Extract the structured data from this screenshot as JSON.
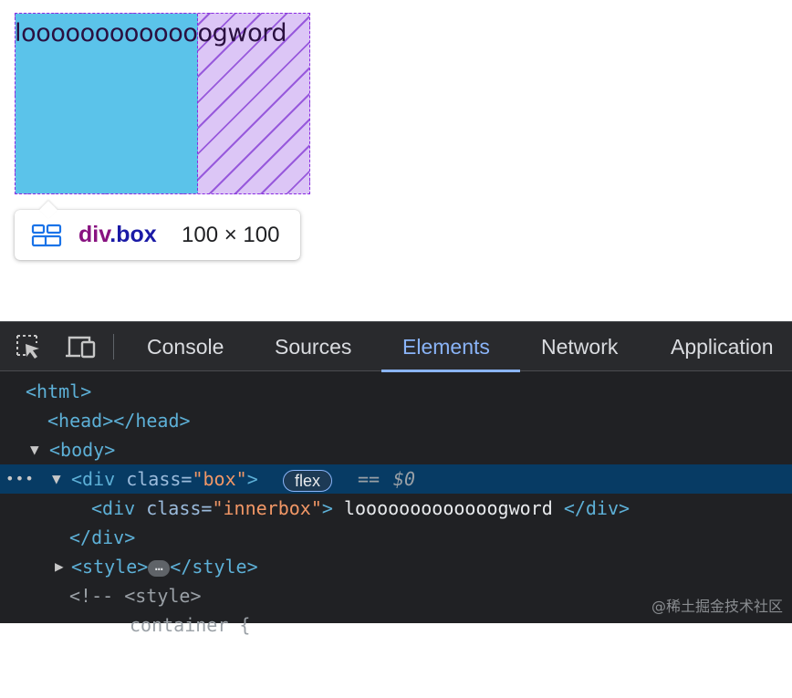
{
  "preview": {
    "box_text": "looooooooooooogword",
    "tooltip": {
      "tag": "div",
      "class": ".box",
      "size": "100 × 100"
    }
  },
  "devtools": {
    "toolbar": {
      "inspect_icon": "element-picker-icon",
      "device_icon": "device-toolbar-icon",
      "tabs": [
        {
          "label": "Console"
        },
        {
          "label": "Sources"
        },
        {
          "label": "Elements"
        },
        {
          "label": "Network"
        },
        {
          "label": "Application"
        }
      ],
      "active_tab": "Elements"
    },
    "dom": {
      "l1": "<html>",
      "l2": "<head></head>",
      "l3_tag": "<body>",
      "l4": {
        "open": "<div ",
        "attr": "class=",
        "val": "\"box\"",
        "close": ">",
        "badge": "flex",
        "eq": "==",
        "dollar": "$0"
      },
      "l5": {
        "open": "<div ",
        "attr": "class=",
        "val": "\"innerbox\"",
        "close": ">",
        "text": " looooooooooooogword ",
        "end": "</div>"
      },
      "l6": "</div>",
      "l7": {
        "open": "<style>",
        "ellipsis": "…",
        "close": "</style>"
      },
      "l8": "<!-- <style>",
      "l9": "container {"
    }
  },
  "watermark": "@稀土掘金技术社区",
  "colors": {
    "selected_row": "#073b64",
    "active_tab": "#8ab4f8",
    "tag": "#5db0d7",
    "attr_value": "#f29766"
  }
}
